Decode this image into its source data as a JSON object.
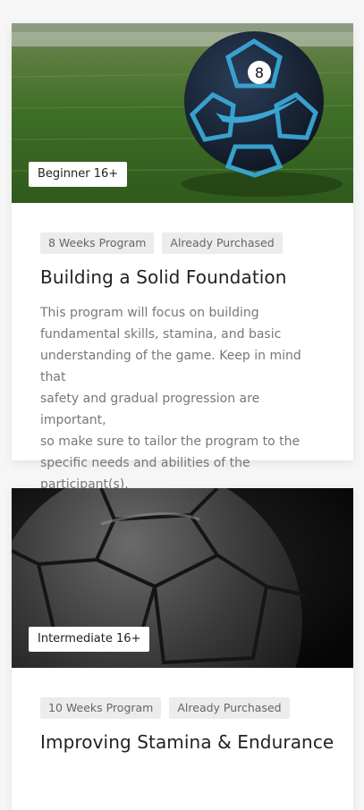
{
  "programs": [
    {
      "level": "Beginner 16+",
      "tags": [
        "8 Weeks Program",
        "Already Purchased"
      ],
      "title": "Building a Solid Foundation",
      "description_lines": [
        "This program will focus on building",
        "fundamental skills, stamina, and basic",
        "understanding of the game. Keep in mind that",
        "safety and gradual progression are important,",
        "so make sure to tailor the program to the",
        "specific needs and abilities of the participant(s)."
      ],
      "image": "soccer-ball-on-grass-photo"
    },
    {
      "level": "Intermediate 16+",
      "tags": [
        "10 Weeks Program",
        "Already Purchased"
      ],
      "title": "Improving Stamina & Endurance",
      "image": "black-and-white-soccer-ball-photo"
    }
  ],
  "colors": {
    "background": "#f6f6f6",
    "card": "#ffffff",
    "tag_bg": "#ececec",
    "ball_blue": "#3aa7d6"
  }
}
